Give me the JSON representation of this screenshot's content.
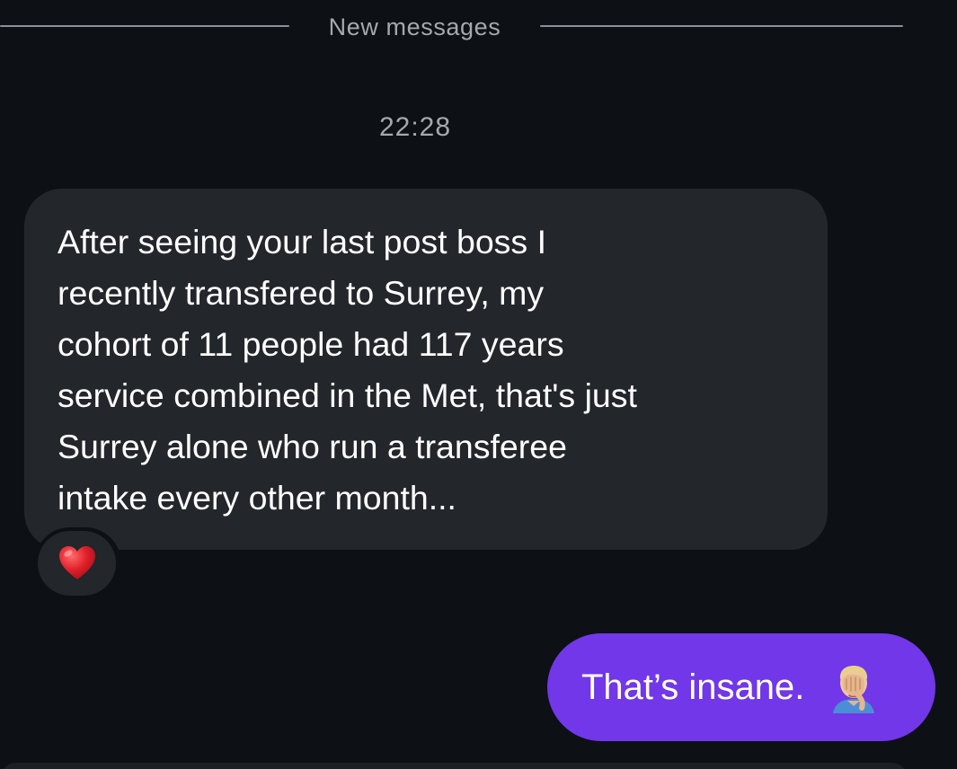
{
  "divider": {
    "label": "New messages"
  },
  "conversation": {
    "timestamp": "22:28",
    "incoming": {
      "lines": [
        "After seeing your last post boss I",
        "recently transfered to Surrey, my",
        "cohort of 11 people had 117 years",
        "service combined in the Met, that's just",
        "Surrey alone who run a transferee",
        "intake every other month..."
      ],
      "reaction_icon": "red-heart-icon"
    },
    "outgoing": {
      "text": "That’s insane.",
      "emoji_icon": "face-palm-icon"
    }
  },
  "colors": {
    "background": "#0d1014",
    "incoming_bubble": "#23262b",
    "outgoing_bubble": "#7137e8",
    "muted_text": "#a5a8ad"
  }
}
